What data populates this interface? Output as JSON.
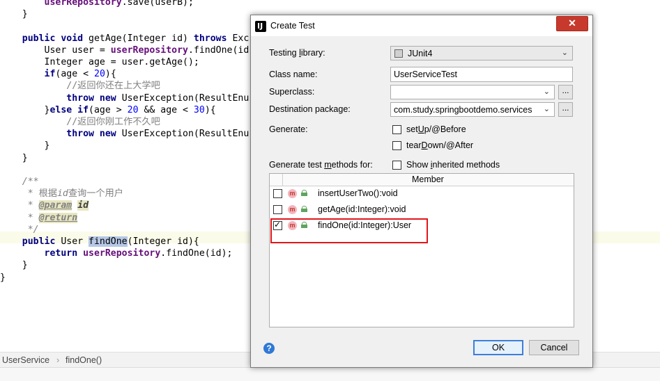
{
  "editor": {
    "lines": [
      {
        "seg": [
          [
            "        ",
            ""
          ],
          [
            "userRepository",
            "fld"
          ],
          [
            ".save(userB);",
            ""
          ]
        ]
      },
      {
        "seg": [
          [
            "    }",
            ""
          ]
        ]
      },
      {
        "seg": [
          [
            "",
            ""
          ]
        ]
      },
      {
        "seg": [
          [
            "    ",
            ""
          ],
          [
            "public void ",
            "kw"
          ],
          [
            "getAge(Integer id) ",
            ""
          ],
          [
            "throws ",
            "kw"
          ],
          [
            "Exc",
            ""
          ]
        ]
      },
      {
        "seg": [
          [
            "        User user = ",
            ""
          ],
          [
            "userRepository",
            "fld"
          ],
          [
            ".findOne(id",
            ""
          ]
        ]
      },
      {
        "seg": [
          [
            "        Integer age = user.getAge();",
            ""
          ]
        ]
      },
      {
        "seg": [
          [
            "        ",
            ""
          ],
          [
            "if",
            "kw"
          ],
          [
            "(age < ",
            ""
          ],
          [
            "20",
            "num"
          ],
          [
            "){",
            ""
          ]
        ]
      },
      {
        "seg": [
          [
            "            ",
            ""
          ],
          [
            "//返回你还在上大学吧",
            "cmt-cn"
          ]
        ]
      },
      {
        "seg": [
          [
            "            ",
            ""
          ],
          [
            "throw new ",
            "kw"
          ],
          [
            "UserException(ResultEnu",
            ""
          ]
        ]
      },
      {
        "seg": [
          [
            "        }",
            ""
          ],
          [
            "else if",
            "kw"
          ],
          [
            "(age > ",
            ""
          ],
          [
            "20",
            "num"
          ],
          [
            " && age < ",
            ""
          ],
          [
            "30",
            "num"
          ],
          [
            "){",
            ""
          ]
        ]
      },
      {
        "seg": [
          [
            "            ",
            ""
          ],
          [
            "//返回你刚工作不久吧",
            "cmt-cn"
          ]
        ]
      },
      {
        "seg": [
          [
            "            ",
            ""
          ],
          [
            "throw new ",
            "kw"
          ],
          [
            "UserException(ResultEnu",
            ""
          ]
        ]
      },
      {
        "seg": [
          [
            "        }",
            ""
          ]
        ]
      },
      {
        "seg": [
          [
            "    }",
            ""
          ]
        ]
      },
      {
        "seg": [
          [
            "",
            ""
          ]
        ]
      },
      {
        "seg": [
          [
            "    ",
            ""
          ],
          [
            "/**",
            "cmt"
          ]
        ]
      },
      {
        "seg": [
          [
            "     ",
            ""
          ],
          [
            "* 根据",
            "cmt-cn"
          ],
          [
            "id",
            "cmt"
          ],
          [
            "查询一个用户",
            "cmt-cn"
          ]
        ]
      },
      {
        "seg": [
          [
            "     ",
            ""
          ],
          [
            "* ",
            "cmt"
          ],
          [
            "@param",
            "tag"
          ],
          [
            " ",
            "cmt"
          ],
          [
            "id",
            "tagval"
          ]
        ]
      },
      {
        "seg": [
          [
            "     ",
            ""
          ],
          [
            "* ",
            "cmt"
          ],
          [
            "@return",
            "tag"
          ]
        ]
      },
      {
        "seg": [
          [
            "     ",
            ""
          ],
          [
            "*/",
            "cmt"
          ]
        ]
      },
      {
        "seg": [
          [
            "    ",
            ""
          ],
          [
            "public ",
            "kw"
          ],
          [
            "User ",
            ""
          ],
          [
            "findOne",
            "hl"
          ],
          [
            "(Integer id){",
            ""
          ]
        ]
      },
      {
        "seg": [
          [
            "        ",
            ""
          ],
          [
            "return ",
            "kw"
          ],
          [
            "userRepository",
            "fld"
          ],
          [
            ".findOne(id);",
            ""
          ]
        ]
      },
      {
        "seg": [
          [
            "    }",
            ""
          ]
        ]
      },
      {
        "seg": [
          [
            "}",
            ""
          ]
        ]
      }
    ]
  },
  "breadcrumb": {
    "class_name": "UserService",
    "separator": "›",
    "method_name": "findOne()"
  },
  "dialog": {
    "title": "Create Test",
    "close_label": "✕",
    "testing_library_label": "Testing library:",
    "testing_library_value": "JUnit4",
    "class_name_label": "Class name:",
    "class_name_value": "UserServiceTest",
    "superclass_label": "Superclass:",
    "superclass_value": "",
    "destination_package_label": "Destination package:",
    "destination_package_value": "com.study.springbootdemo.services",
    "browse_label": "...",
    "generate_label": "Generate:",
    "setup_label": "setUp/@Before",
    "setup_checked": false,
    "teardown_label": "tearDown/@After",
    "teardown_checked": false,
    "generate_methods_label": "Generate test methods for:",
    "show_inherited_label": "Show inherited methods",
    "show_inherited_checked": false,
    "table_header": "Member",
    "members": [
      {
        "name": "insertUserTwo():void",
        "checked": false
      },
      {
        "name": "getAge(id:Integer):void",
        "checked": false
      },
      {
        "name": "findOne(id:Integer):User",
        "checked": true
      }
    ],
    "method_icon_letter": "m",
    "help_label": "?",
    "ok_label": "OK",
    "cancel_label": "Cancel"
  }
}
